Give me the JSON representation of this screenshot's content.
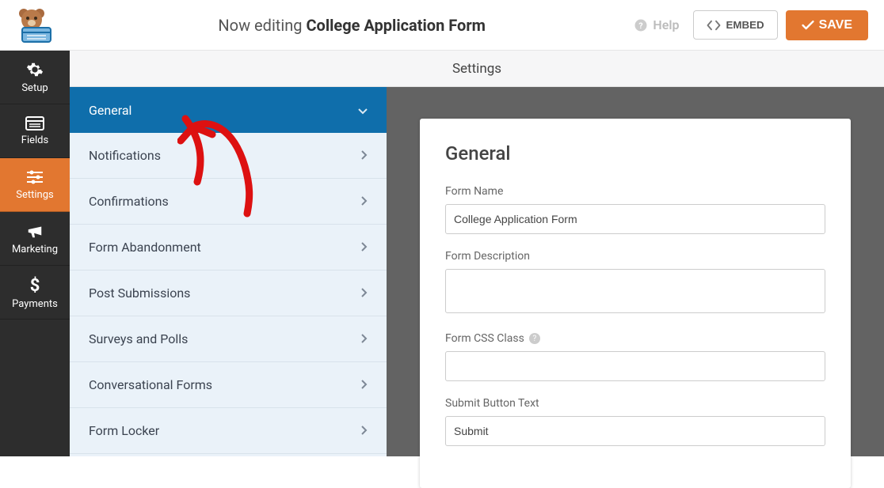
{
  "header": {
    "title_prefix": "Now editing ",
    "title_bold": "College Application Form",
    "help_label": "Help",
    "embed_label": "EMBED",
    "save_label": "SAVE"
  },
  "vnav": {
    "items": [
      {
        "label": "Setup"
      },
      {
        "label": "Fields"
      },
      {
        "label": "Settings",
        "active": true
      },
      {
        "label": "Marketing"
      },
      {
        "label": "Payments"
      }
    ]
  },
  "settings_strip": {
    "title": "Settings"
  },
  "settings_list": {
    "items": [
      {
        "label": "General",
        "active": true
      },
      {
        "label": "Notifications"
      },
      {
        "label": "Confirmations"
      },
      {
        "label": "Form Abandonment"
      },
      {
        "label": "Post Submissions"
      },
      {
        "label": "Surveys and Polls"
      },
      {
        "label": "Conversational Forms"
      },
      {
        "label": "Form Locker"
      }
    ]
  },
  "panel": {
    "heading": "General",
    "form_name_label": "Form Name",
    "form_name_value": "College Application Form",
    "form_desc_label": "Form Description",
    "form_desc_value": "",
    "form_css_label": "Form CSS Class",
    "form_css_value": "",
    "submit_btn_label": "Submit Button Text",
    "submit_btn_value": "Submit"
  }
}
